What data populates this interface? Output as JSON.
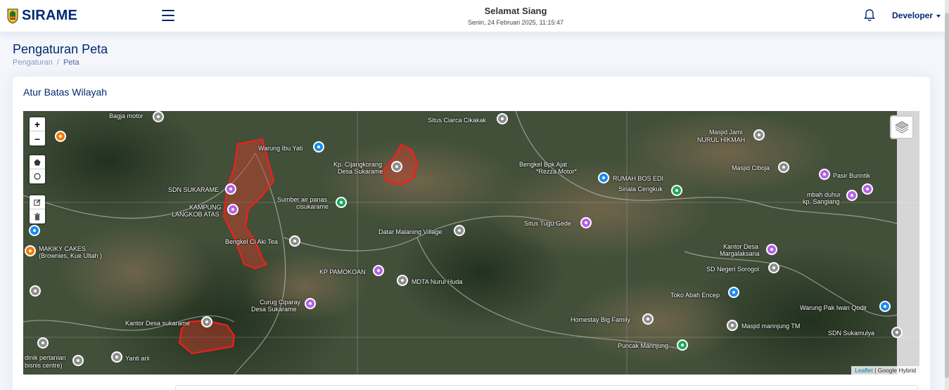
{
  "header": {
    "brand": "SIRAME",
    "greeting": "Selamat Siang",
    "datetime": "Senin, 24 Februari 2025, 11:15:47",
    "user": "Developer"
  },
  "page": {
    "title": "Pengaturan Peta",
    "breadcrumb": [
      "Pengaturan",
      "Peta"
    ]
  },
  "card": {
    "title": "Atur Batas Wilayah"
  },
  "map": {
    "zoom_in": "+",
    "zoom_out": "–",
    "attribution_link": "Leaflet",
    "attribution_text": " | Google Hybrid",
    "labels": [
      "Bagja motor",
      "Situs Ciarca Cikakak",
      "Masjid Jami",
      "NURUL HIKMAH",
      "Warung Ibu Yati",
      "Kp. Cijangkorang",
      "Desa Sukarame",
      "Bengkel Bpk Ajat",
      "*Rezza Motor*",
      "RUMAH BOS EDI",
      "Masjid Ciboja",
      "Pasir Burintik",
      "Sinala Cengkuk",
      "mbah duhur",
      "kp. Sangiang",
      "SDN SUKARAME",
      "Sumber air panas",
      "cisukarame",
      "KAMPUNG",
      "LANGKOB ATAS",
      "Datar Malaning Village",
      "Situs Tugu Gede",
      "MAKIKY CAKES",
      "(Brownies, Kue Ultah )",
      "Bengkel Ci Aki Tea",
      "Kantor Desa",
      "Margalaksana",
      "KP PAMOKOAN",
      "SD Negeri Sorogol",
      "MDTA Nurul Huda",
      "Toko Abah Encep",
      "Curug Ciparay",
      "Desa Sukarame",
      "Warung Pak Iwan Qodir",
      "Kantor Desa sukarame",
      "Homestay Big Family",
      "Masjid marinjung TM",
      "SDN Sukamulya",
      "Puncak Marinjung",
      "Yanti arii",
      "dinik pertanian",
      "bisnis centre)"
    ]
  }
}
